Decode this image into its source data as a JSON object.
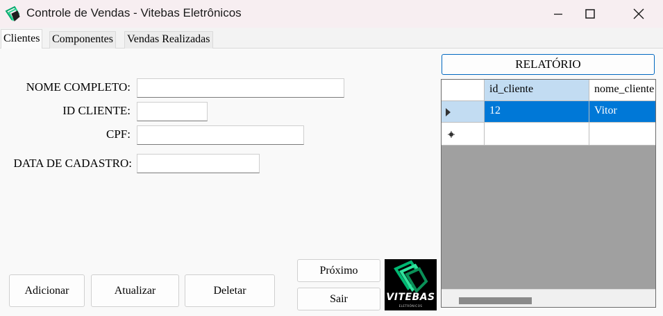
{
  "window": {
    "title": "Controle de Vendas - Vitebas Eletrônicos",
    "app_icon": "vitebas-logo-icon",
    "controls": {
      "minimize": "minimize-icon",
      "maximize": "maximize-icon",
      "close": "close-icon"
    }
  },
  "tabs": [
    {
      "label": "Clientes",
      "active": true
    },
    {
      "label": "Componentes",
      "active": false
    },
    {
      "label": "Vendas Realizadas",
      "active": false
    }
  ],
  "form": {
    "nome_completo": {
      "label": "NOME COMPLETO:",
      "value": ""
    },
    "id_cliente": {
      "label": "ID CLIENTE:",
      "value": ""
    },
    "cpf": {
      "label": "CPF:",
      "value": ""
    },
    "data_cadastro": {
      "label": "DATA DE CADASTRO:",
      "value": ""
    }
  },
  "buttons": {
    "adicionar": "Adicionar",
    "atualizar": "Atualizar",
    "deletar": "Deletar",
    "proximo": "Próximo",
    "sair": "Sair",
    "relatorio": "RELATÓRIO"
  },
  "logo": {
    "text": "VITEBAS",
    "subtext": "ELETRÔNICOS"
  },
  "grid": {
    "columns": [
      "id_cliente",
      "nome_cliente"
    ],
    "rows": [
      {
        "id_cliente": "12",
        "nome_cliente": "Vitor"
      }
    ],
    "current_row_icon": "row-pointer-icon",
    "new_row_icon": "new-row-asterisk-icon",
    "colors": {
      "selection": "#0078d7",
      "header_selected": "#c2dcf2",
      "empty_area": "#a0a0a0"
    }
  }
}
